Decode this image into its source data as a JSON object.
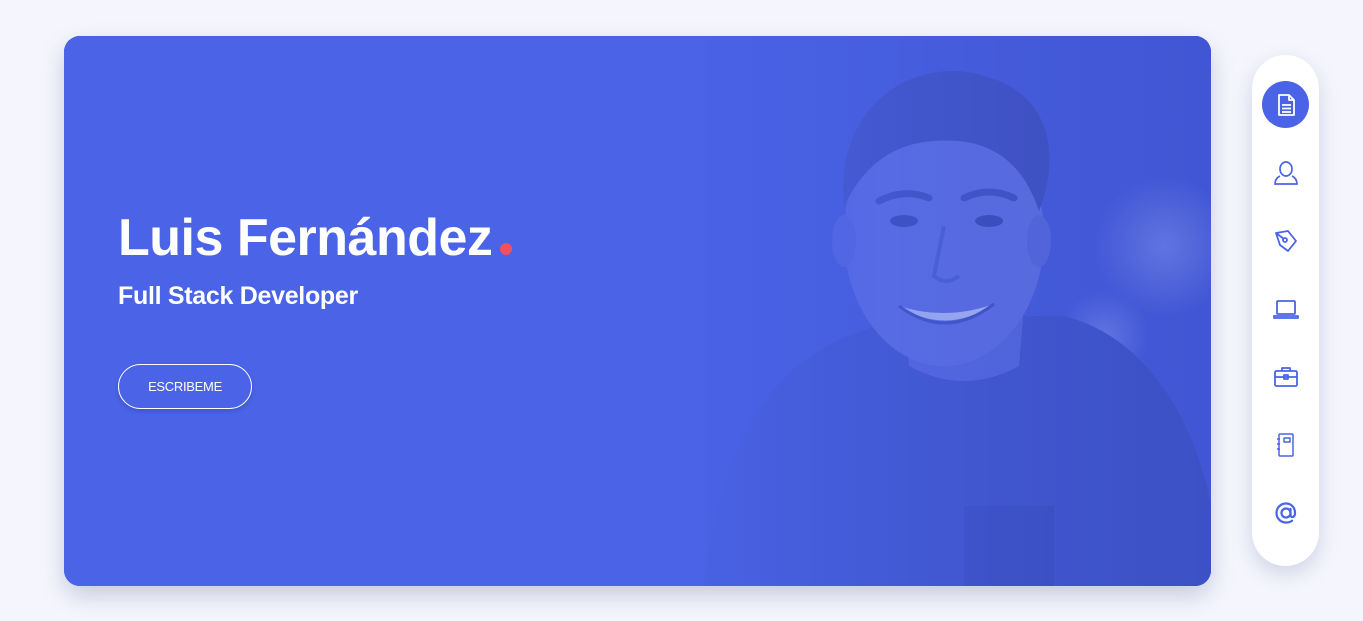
{
  "hero": {
    "name": "Luis Fernández",
    "subtitle": "Full Stack Developer",
    "button_label": "ESCRIBEME",
    "accent_dot_color": "#f24f5f",
    "background_color": "#4a63e7"
  },
  "sidenav": {
    "items": [
      {
        "icon": "document-icon",
        "active": true
      },
      {
        "icon": "user-icon",
        "active": false
      },
      {
        "icon": "pen-nib-icon",
        "active": false
      },
      {
        "icon": "laptop-icon",
        "active": false
      },
      {
        "icon": "briefcase-icon",
        "active": false
      },
      {
        "icon": "notebook-icon",
        "active": false
      },
      {
        "icon": "at-sign-icon",
        "active": false
      }
    ],
    "active_color": "#4a63e7",
    "icon_color": "#4a63e7"
  }
}
